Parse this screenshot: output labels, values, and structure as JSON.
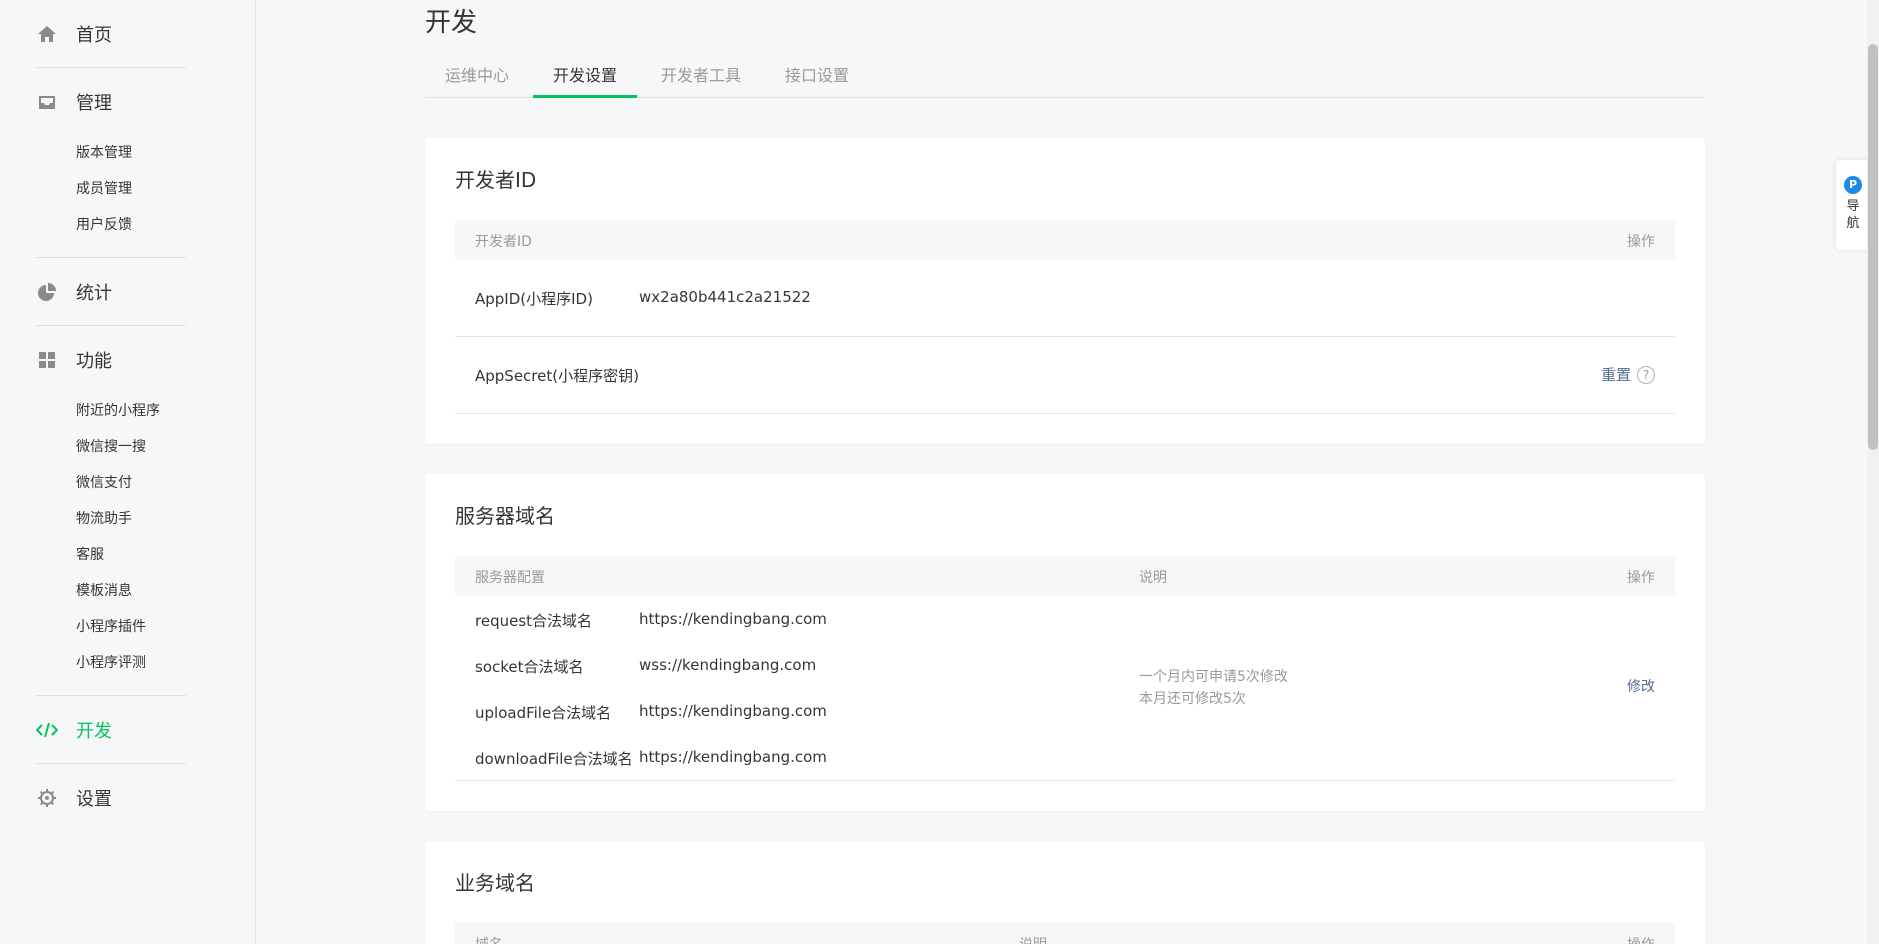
{
  "sidebar": {
    "home": "首页",
    "manage": "管理",
    "manage_items": [
      "版本管理",
      "成员管理",
      "用户反馈"
    ],
    "stats": "统计",
    "features": "功能",
    "feature_items": [
      "附近的小程序",
      "微信搜一搜",
      "微信支付",
      "物流助手",
      "客服",
      "模板消息",
      "小程序插件",
      "小程序评测"
    ],
    "dev": "开发",
    "settings": "设置"
  },
  "main": {
    "title": "开发",
    "tabs": [
      "运维中心",
      "开发设置",
      "开发者工具",
      "接口设置"
    ],
    "active_tab": "开发设置"
  },
  "dev_id": {
    "title": "开发者ID",
    "col_name": "开发者ID",
    "col_action": "操作",
    "appid_label": "AppID(小程序ID)",
    "appid_value": "wx2a80b441c2a21522",
    "secret_label": "AppSecret(小程序密钥)",
    "secret_action": "重置",
    "help": "?"
  },
  "server": {
    "title": "服务器域名",
    "col_config": "服务器配置",
    "col_desc": "说明",
    "col_action": "操作",
    "rows": [
      {
        "key": "request合法域名",
        "value": "https://kendingbang.com"
      },
      {
        "key": "socket合法域名",
        "value": "wss://kendingbang.com"
      },
      {
        "key": "uploadFile合法域名",
        "value": "https://kendingbang.com"
      },
      {
        "key": "downloadFile合法域名",
        "value": "https://kendingbang.com"
      }
    ],
    "desc_line1": "一个月内可申请5次修改",
    "desc_line2": "本月还可修改5次",
    "action": "修改"
  },
  "business": {
    "title": "业务域名",
    "col_domain": "域名",
    "col_desc": "说明",
    "col_action": "操作"
  },
  "float_nav": {
    "badge": "P",
    "line1": "导",
    "line2": "航"
  },
  "colors": {
    "accent": "#07c160",
    "link": "#576b95"
  }
}
